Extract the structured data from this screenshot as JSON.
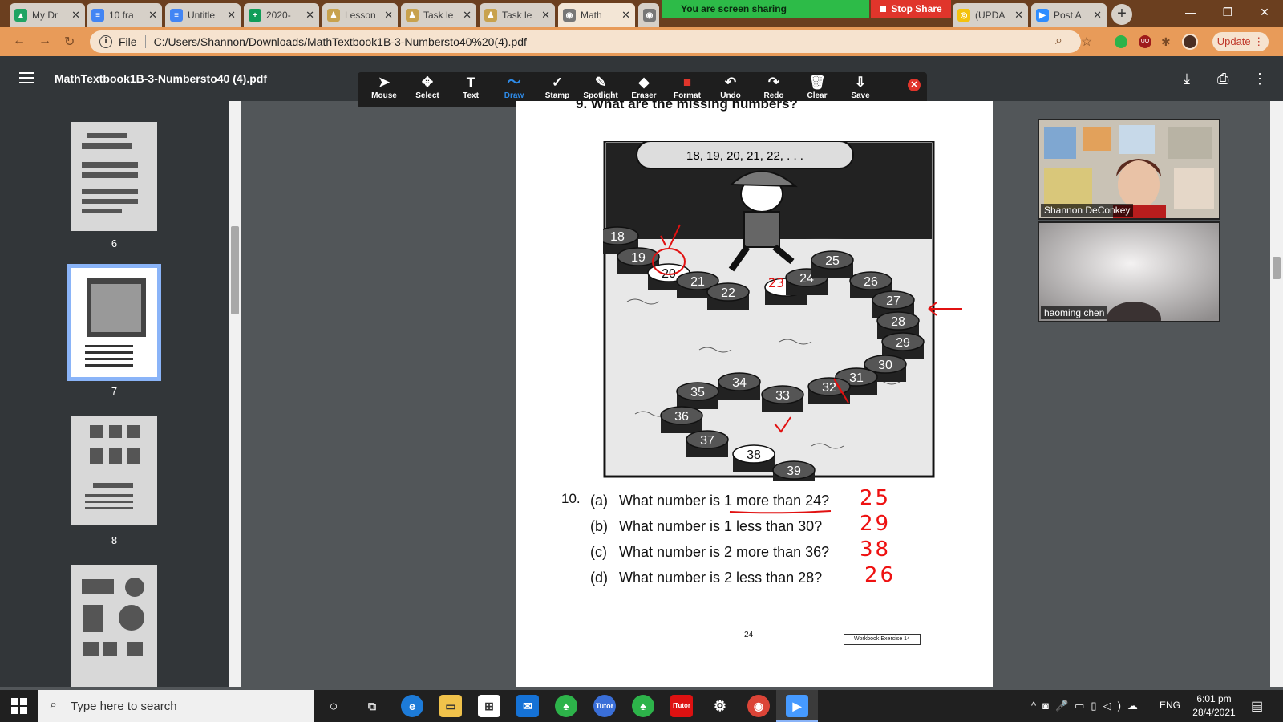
{
  "browser": {
    "tabs": [
      {
        "title": "My Dr",
        "favcolor": "#1fa463",
        "glyph": "▲"
      },
      {
        "title": "10 fra",
        "favcolor": "#4285f4",
        "glyph": "≡"
      },
      {
        "title": "Untitle",
        "favcolor": "#4285f4",
        "glyph": "≡"
      },
      {
        "title": "2020-",
        "favcolor": "#0f9d58",
        "glyph": "+"
      },
      {
        "title": "Lesson",
        "favcolor": "#c8a24d",
        "glyph": "♟"
      },
      {
        "title": "Task le",
        "favcolor": "#c8a24d",
        "glyph": "♟"
      },
      {
        "title": "Task le",
        "favcolor": "#c8a24d",
        "glyph": "♟"
      },
      {
        "title": "Math",
        "favcolor": "#777777",
        "glyph": "◉"
      },
      {
        "title": "",
        "favcolor": "#777777",
        "glyph": "◉"
      },
      {
        "title": "(UPDA",
        "favcolor": "#f4c20d",
        "glyph": "◎"
      },
      {
        "title": "Post A",
        "favcolor": "#2d8cff",
        "glyph": "▶"
      }
    ],
    "share_status": "You are screen sharing",
    "stop_share_label": "Stop Share",
    "address_prefix": "File",
    "address": "C:/Users/Shannon/Downloads/MathTextbook1B-3-Numbersto40%20(4).pdf",
    "update_label": "Update"
  },
  "pdf": {
    "title": "MathTextbook1B-3-Numbersto40 (4).pdf",
    "tools": [
      {
        "label": "Mouse",
        "icon": "➤"
      },
      {
        "label": "Select",
        "icon": "✥"
      },
      {
        "label": "Text",
        "icon": "T"
      },
      {
        "label": "Draw",
        "icon": "〜"
      },
      {
        "label": "Stamp",
        "icon": "✓"
      },
      {
        "label": "Spotlight",
        "icon": "✎"
      },
      {
        "label": "Eraser",
        "icon": "◆"
      },
      {
        "label": "Format",
        "icon": "■"
      },
      {
        "label": "Undo",
        "icon": "↶"
      },
      {
        "label": "Redo",
        "icon": "↷"
      },
      {
        "label": "Clear",
        "icon": "🗑"
      },
      {
        "label": "Save",
        "icon": "⇩"
      }
    ],
    "active_tool": "Draw",
    "page_numbers": [
      "6",
      "7",
      "8"
    ],
    "selected_page": "7"
  },
  "page": {
    "q9_heading": "9.   What are the missing numbers?",
    "sequence_bubble": "18, 19, 20, 21, 22, . . .",
    "stones": [
      "18",
      "19",
      "20",
      "21",
      "22",
      "23",
      "24",
      "25",
      "26",
      "27",
      "28",
      "29",
      "30",
      "31",
      "32",
      "33",
      "34",
      "35",
      "36",
      "37",
      "38",
      "39"
    ],
    "q10_number": "10.",
    "questions": [
      {
        "letter": "(a)",
        "text": "What number is 1 more than 24?",
        "answer": "25"
      },
      {
        "letter": "(b)",
        "text": "What number is 1 less than 30?",
        "answer": "29"
      },
      {
        "letter": "(c)",
        "text": "What number is 2 more than 36?",
        "answer": "38"
      },
      {
        "letter": "(d)",
        "text": "What number is 2 less than 28?",
        "answer": "26"
      }
    ],
    "page_number": "24",
    "workbook_label": "Workbook Exercise 14"
  },
  "video": {
    "participants": [
      "Shannon DeConkey",
      "haoming chen"
    ]
  },
  "taskbar": {
    "search_placeholder": "Type here to search",
    "language": "ENG",
    "time": "6:01 pm",
    "date": "28/4/2021"
  },
  "colors": {
    "accent_blue": "#2e8ae6",
    "annotation_red": "#e11111",
    "share_green": "#2dbb48"
  }
}
